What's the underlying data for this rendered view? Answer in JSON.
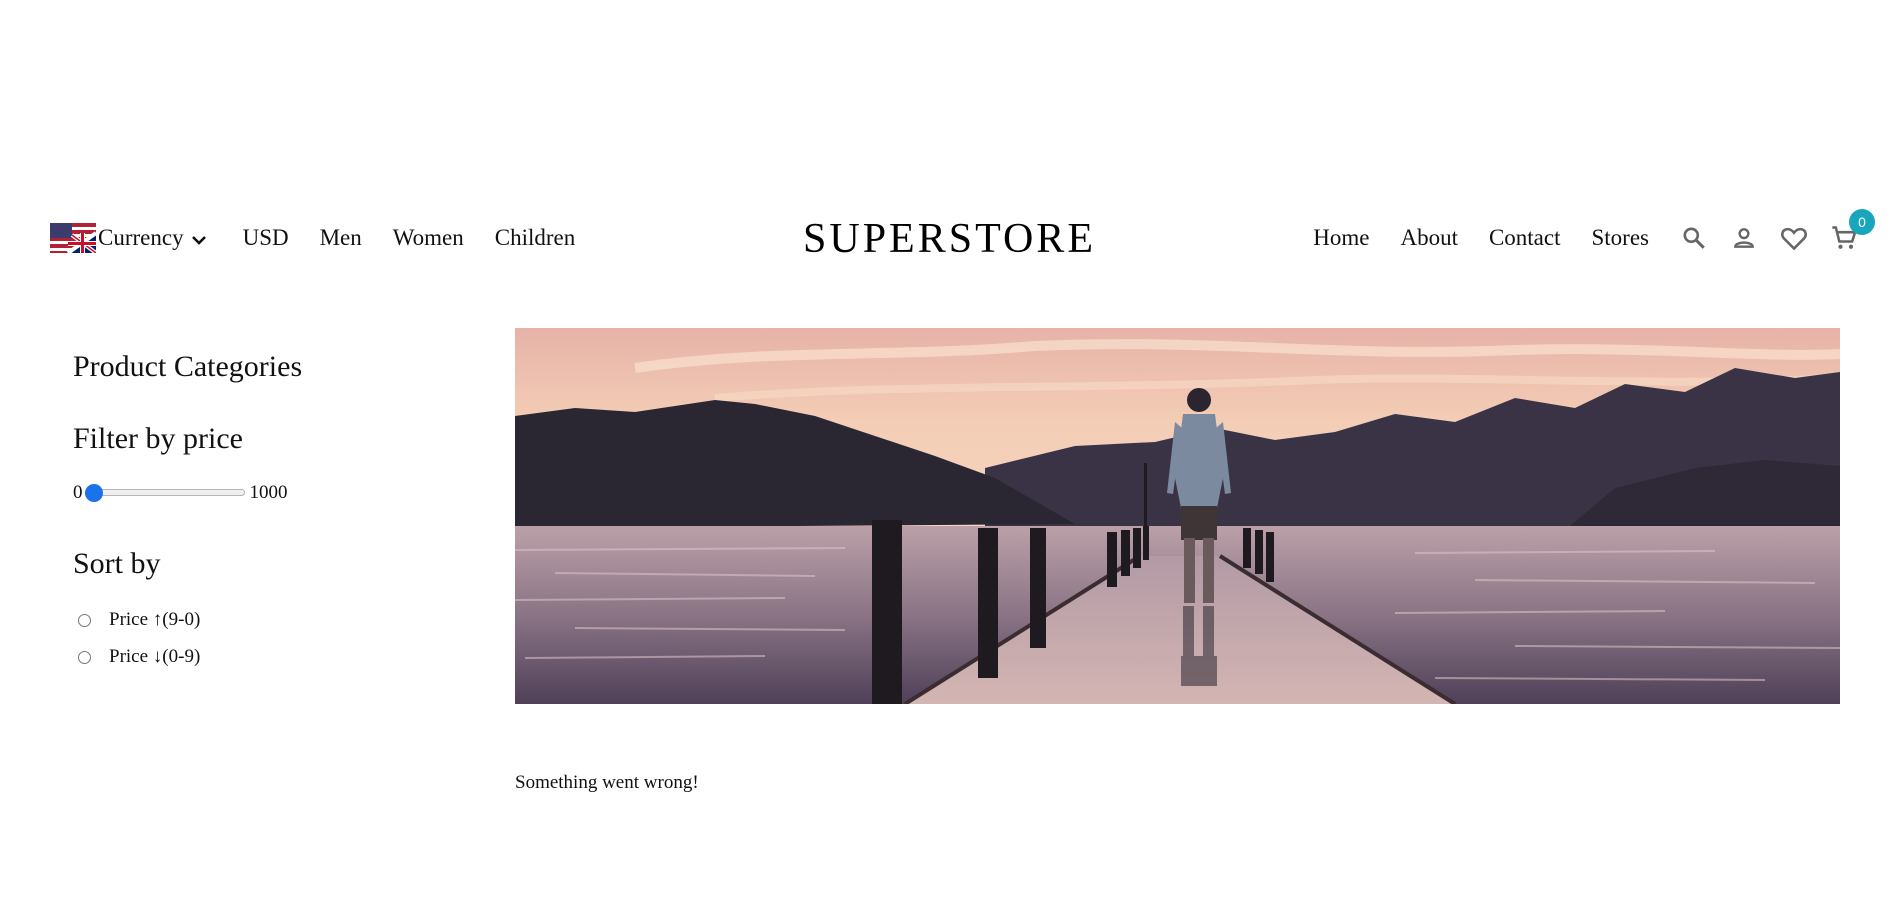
{
  "header": {
    "currency_label": "Currency",
    "currency_value": "USD",
    "left_links": [
      "Men",
      "Women",
      "Children"
    ],
    "logo": "SUPERSTORE",
    "right_links": [
      "Home",
      "About",
      "Contact",
      "Stores"
    ],
    "cart_count": "0",
    "icons": [
      "uk-flag-icon",
      "chevron-down-icon",
      "search-icon",
      "user-icon",
      "heart-icon",
      "cart-icon"
    ]
  },
  "sidebar": {
    "categories_heading": "Product Categories",
    "filter_heading": "Filter by price",
    "price_min": "0",
    "price_max": "1000",
    "slider_value": 0,
    "sort_heading": "Sort by",
    "sort_options": [
      "Price ↑(9-0)",
      "Price ↓(0-9)"
    ]
  },
  "main": {
    "error_message": "Something went wrong!"
  },
  "colors": {
    "accent": "#18a6bd",
    "slider": "#1a73e8"
  }
}
